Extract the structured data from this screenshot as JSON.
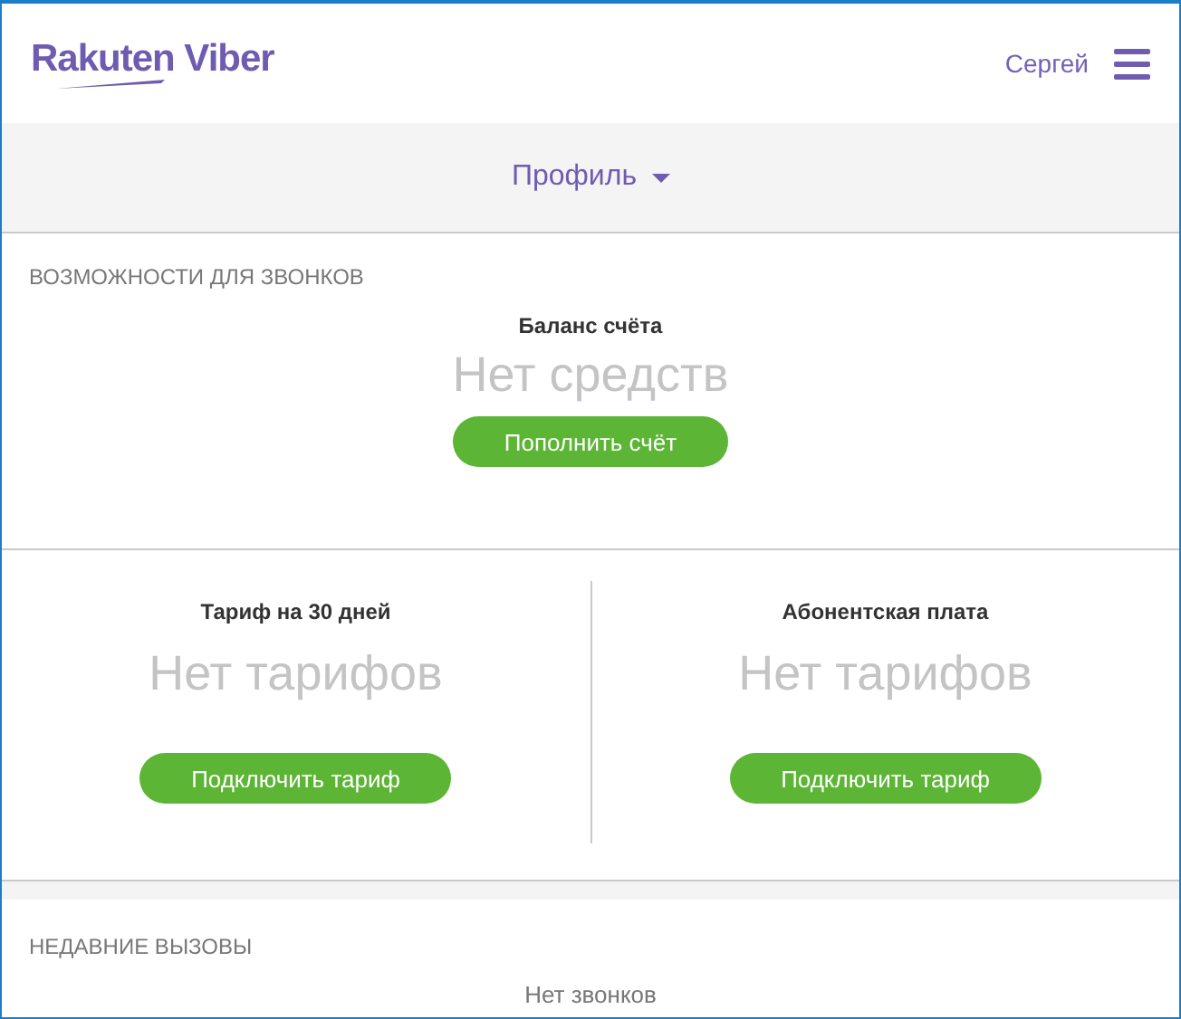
{
  "header": {
    "logo": "Rakuten Viber",
    "user": "Сергей"
  },
  "nav": {
    "label": "Профиль"
  },
  "features": {
    "title": "ВОЗМОЖНОСТИ ДЛЯ ЗВОНКОВ",
    "balance_label": "Баланс счёта",
    "balance_value": "Нет средств",
    "button": "Пополнить счёт"
  },
  "plans": [
    {
      "label": "Тариф на 30 дней",
      "value": "Нет тарифов",
      "button": "Подключить тариф"
    },
    {
      "label": "Абонентская плата",
      "value": "Нет тарифов",
      "button": "Подключить тариф"
    }
  ],
  "recent_calls": {
    "title": "НЕДАВНИЕ ВЫЗОВЫ",
    "empty": "Нет звонков"
  }
}
